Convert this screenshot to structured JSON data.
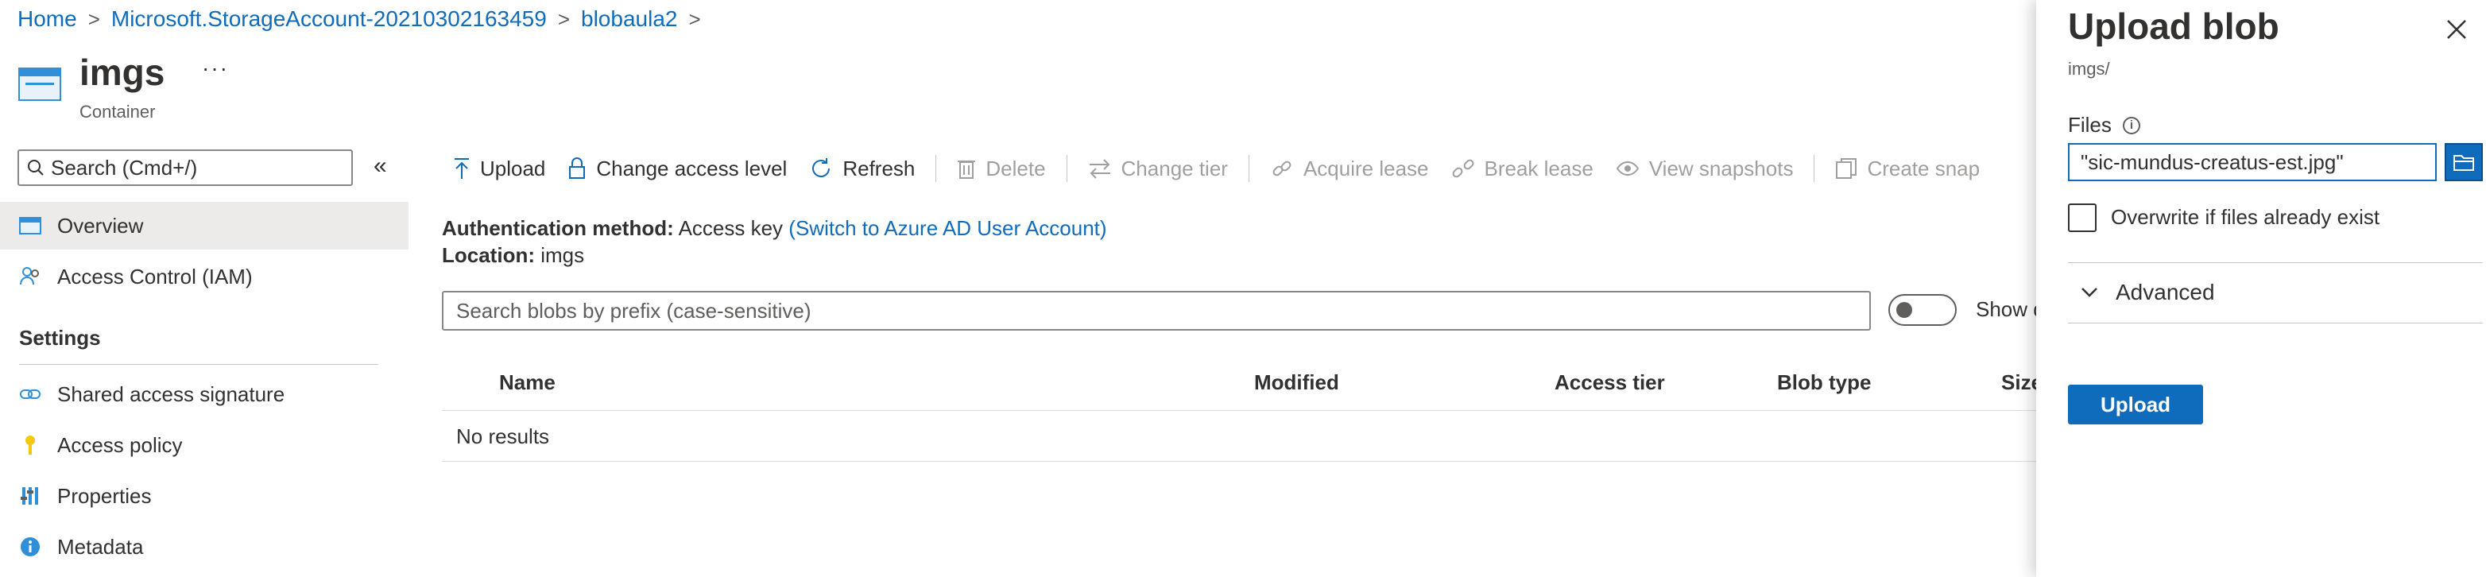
{
  "breadcrumb": [
    "Home",
    "Microsoft.StorageAccount-20210302163459",
    "blobaula2"
  ],
  "header": {
    "title": "imgs",
    "subtitle": "Container",
    "more": "···"
  },
  "sidebar": {
    "search_placeholder": "Search (Cmd+/)",
    "collapse_icon": "«",
    "items": [
      {
        "label": "Overview",
        "icon": "container-icon",
        "active": true
      },
      {
        "label": "Access Control (IAM)",
        "icon": "people-icon"
      }
    ],
    "settings_title": "Settings",
    "settings_items": [
      {
        "label": "Shared access signature",
        "icon": "link-icon"
      },
      {
        "label": "Access policy",
        "icon": "key-icon"
      },
      {
        "label": "Properties",
        "icon": "properties-icon"
      },
      {
        "label": "Metadata",
        "icon": "info-icon"
      }
    ]
  },
  "toolbar": {
    "upload": "Upload",
    "change_access": "Change access level",
    "refresh": "Refresh",
    "delete": "Delete",
    "change_tier": "Change tier",
    "acquire_lease": "Acquire lease",
    "break_lease": "Break lease",
    "view_snapshots": "View snapshots",
    "create_snapshot": "Create snap"
  },
  "auth": {
    "label": "Authentication method:",
    "value": "Access key",
    "switch_link": "(Switch to Azure AD User Account)"
  },
  "location": {
    "label": "Location:",
    "value": "imgs"
  },
  "blob_search": {
    "placeholder": "Search blobs by prefix (case-sensitive)"
  },
  "show_toggle_label": "Show d",
  "table": {
    "columns": [
      "Name",
      "Modified",
      "Access tier",
      "Blob type",
      "Size"
    ],
    "empty_text": "No results"
  },
  "panel": {
    "title": "Upload blob",
    "path": "imgs/",
    "files_label": "Files",
    "file_value": "\"sic-mundus-creatus-est.jpg\"",
    "overwrite_label": "Overwrite if files already exist",
    "advanced_label": "Advanced",
    "upload_button": "Upload"
  },
  "colors": {
    "accent": "#0f6cbd",
    "disabled": "#a19f9d"
  }
}
